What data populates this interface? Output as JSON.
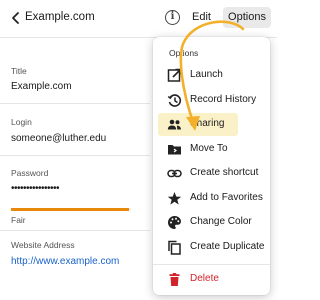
{
  "header": {
    "title": "Example.com",
    "info_glyph": "i",
    "edit_label": "Edit",
    "options_label": "Options"
  },
  "fields": {
    "title_label": "Title",
    "title_value": "Example.com",
    "login_label": "Login",
    "login_value": "someone@luther.edu",
    "password_label": "Password",
    "password_value": "••••••••••••••••",
    "strength_label": "Fair",
    "strength_fraction": 0.98,
    "strength_color": "#e8890c",
    "website_label": "Website Address",
    "website_value": "http://www.example.com"
  },
  "menu": {
    "heading": "Options",
    "items": [
      {
        "label": "Launch",
        "icon": "launch-icon"
      },
      {
        "label": "Record History",
        "icon": "history-icon"
      },
      {
        "label": "Sharing",
        "icon": "people-icon",
        "highlighted": true
      },
      {
        "label": "Move To",
        "icon": "folder-icon"
      },
      {
        "label": "Create shortcut",
        "icon": "link-icon"
      },
      {
        "label": "Add to Favorites",
        "icon": "star-icon"
      },
      {
        "label": "Change Color",
        "icon": "palette-icon"
      },
      {
        "label": "Create Duplicate",
        "icon": "copy-icon"
      },
      {
        "label": "Delete",
        "icon": "trash-icon",
        "danger": true
      }
    ]
  },
  "colors": {
    "highlight": "#fbf1c8",
    "arrow": "#f3b02a",
    "danger": "#d1232a",
    "link": "#1b63c8"
  }
}
